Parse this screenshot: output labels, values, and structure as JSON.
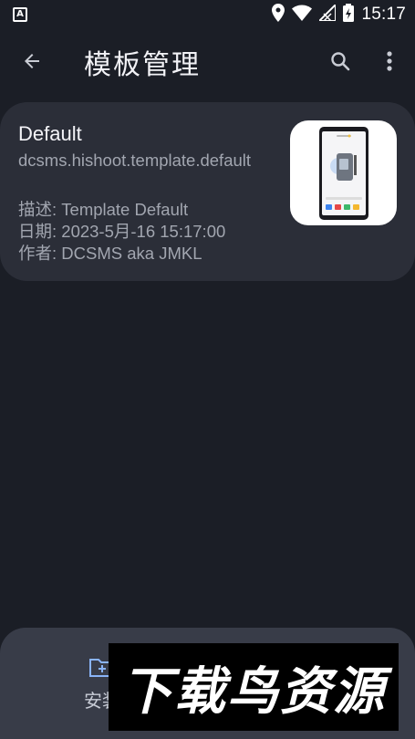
{
  "status_bar": {
    "time": "15:17",
    "left_badge": "A"
  },
  "app_bar": {
    "title": "模板管理"
  },
  "template_card": {
    "name": "Default",
    "id": "dcsms.hishoot.template.default",
    "description_line": "描述: Template Default",
    "date_line": "日期: 2023-5月-16 15:17:00",
    "author_line": "作者: DCSMS aka JMKL"
  },
  "bottom": {
    "install_label": "安装",
    "overlay_text": "下载鸟资源"
  },
  "colors": {
    "background": "#1b1e26",
    "card": "#2b2e38",
    "sheet": "#383c48",
    "install_accent": "#8ab4f8"
  }
}
